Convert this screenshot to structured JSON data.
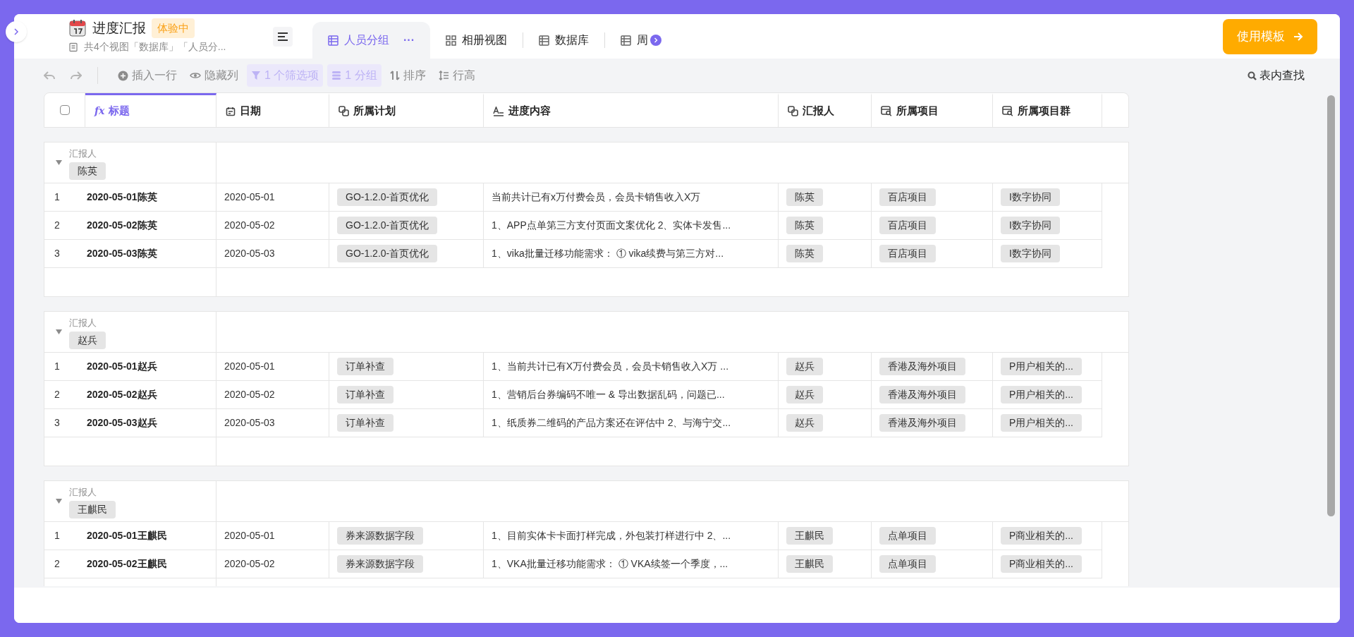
{
  "header": {
    "title": "进度汇报",
    "badge": "体验中",
    "subtitle": "共4个视图「数据库」「人员分...",
    "template_button": "使用模板"
  },
  "tabs": [
    {
      "label": "人员分组",
      "selected": true,
      "more": "···"
    },
    {
      "label": "相册视图",
      "selected": false
    },
    {
      "label": "数据库",
      "selected": false
    },
    {
      "label": "周",
      "selected": false
    }
  ],
  "toolbar": [
    {
      "label": "插入一行",
      "active": false
    },
    {
      "label": "隐藏列",
      "active": false
    },
    {
      "label": "1 个筛选项",
      "active": true
    },
    {
      "label": "1 分组",
      "active": true
    },
    {
      "label": "排序",
      "active": false
    },
    {
      "label": "行高",
      "active": false
    }
  ],
  "select_all": {
    "checked": false
  },
  "search": "表内查找",
  "columns": [
    {
      "label": "标题",
      "kind": "formula",
      "symbol": "fx",
      "selected": true
    },
    {
      "label": "日期",
      "kind": "date",
      "selected": false
    },
    {
      "label": "所属计划",
      "kind": "link",
      "selected": false
    },
    {
      "label": "进度内容",
      "kind": "text",
      "selected": false
    },
    {
      "label": "汇报人",
      "kind": "link",
      "selected": false
    },
    {
      "label": "所属项目",
      "kind": "lookup",
      "selected": false
    },
    {
      "label": "所属项目群",
      "kind": "lookup",
      "selected": false
    }
  ],
  "groups": [
    {
      "label": "汇报人",
      "value": "陈英",
      "rows": [
        {
          "index": "1",
          "title": "2020-05-01陈英",
          "date": "2020-05-01",
          "plan": "GO-1.2.0-首页优化",
          "content": "当前共计已有x万付费会员，会员卡销售收入X万",
          "reporter": "陈英",
          "project": "百店项目",
          "project_group": "I数字协同"
        },
        {
          "index": "2",
          "title": "2020-05-02陈英",
          "date": "2020-05-02",
          "plan": "GO-1.2.0-首页优化",
          "content": "1、APP点单第三方支付页面文案优化 2、实体卡发售...",
          "reporter": "陈英",
          "project": "百店项目",
          "project_group": "I数字协同"
        },
        {
          "index": "3",
          "title": "2020-05-03陈英",
          "date": "2020-05-03",
          "plan": "GO-1.2.0-首页优化",
          "content": "1、vika批量迁移功能需求： ① vika续费与第三方对...",
          "reporter": "陈英",
          "project": "百店项目",
          "project_group": "I数字协同"
        }
      ]
    },
    {
      "label": "汇报人",
      "value": "赵兵",
      "rows": [
        {
          "index": "1",
          "title": "2020-05-01赵兵",
          "date": "2020-05-01",
          "plan": "订单补查",
          "content": "1、当前共计已有X万付费会员，会员卡销售收入X万 ...",
          "reporter": "赵兵",
          "project": "香港及海外项目",
          "project_group": "P用户相关的..."
        },
        {
          "index": "2",
          "title": "2020-05-02赵兵",
          "date": "2020-05-02",
          "plan": "订单补查",
          "content": "1、营销后台券编码不唯一 & 导出数据乱码，问题已...",
          "reporter": "赵兵",
          "project": "香港及海外项目",
          "project_group": "P用户相关的..."
        },
        {
          "index": "3",
          "title": "2020-05-03赵兵",
          "date": "2020-05-03",
          "plan": "订单补查",
          "content": "1、纸质券二维码的产品方案还在评估中 2、与海宁交...",
          "reporter": "赵兵",
          "project": "香港及海外项目",
          "project_group": "P用户相关的..."
        }
      ]
    },
    {
      "label": "汇报人",
      "value": "王麒民",
      "rows": [
        {
          "index": "1",
          "title": "2020-05-01王麒民",
          "date": "2020-05-01",
          "plan": "券来源数据字段",
          "content": "1、目前实体卡卡面打样完成，外包装打样进行中 2、...",
          "reporter": "王麒民",
          "project": "点单项目",
          "project_group": "P商业相关的..."
        },
        {
          "index": "2",
          "title": "2020-05-02王麒民",
          "date": "2020-05-02",
          "plan": "券来源数据字段",
          "content": "1、VKA批量迁移功能需求： ① VKA续签一个季度，...",
          "reporter": "王麒民",
          "project": "点单项目",
          "project_group": "P商业相关的..."
        }
      ]
    }
  ]
}
